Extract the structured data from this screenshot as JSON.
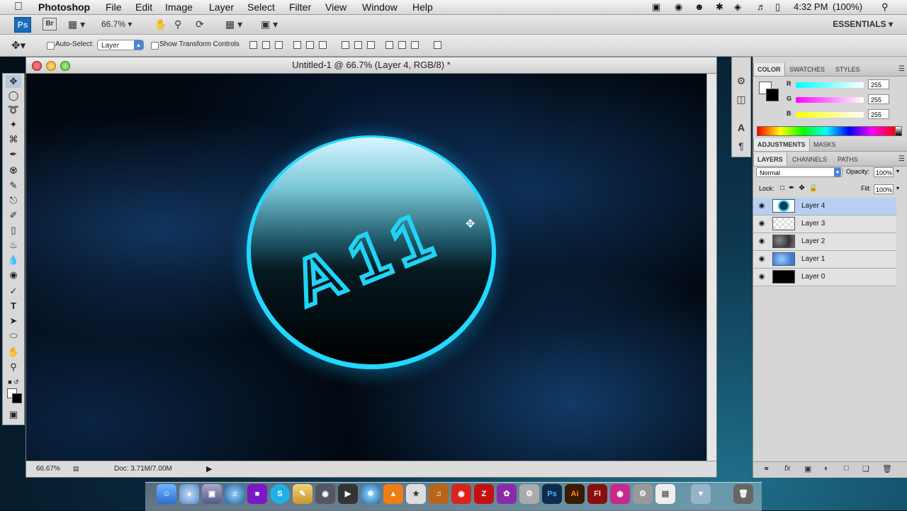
{
  "menubar": {
    "app_name": "Photoshop",
    "menus": [
      "File",
      "Edit",
      "Image",
      "Layer",
      "Select",
      "Filter",
      "View",
      "Window",
      "Help"
    ],
    "clock": "4:32 PM",
    "battery": "(100%)"
  },
  "appbar": {
    "ps_label": "Ps",
    "br_label": "Br",
    "zoom": "66.7%",
    "workspace": "ESSENTIALS"
  },
  "options": {
    "auto_select_label": "Auto-Select:",
    "auto_select_value": "Layer",
    "show_transform_label": "Show Transform Controls"
  },
  "document": {
    "title": "Untitled-1 @ 66.7% (Layer 4, RGB/8) *",
    "status_zoom": "66.67%",
    "status_doc": "Doc: 3.71M/7.00M",
    "canvas_text": "A11"
  },
  "color_panel": {
    "tabs": [
      "COLOR",
      "SWATCHES",
      "STYLES"
    ],
    "r_label": "R",
    "g_label": "G",
    "b_label": "B",
    "r_value": "255",
    "g_value": "255",
    "b_value": "255"
  },
  "adjustments_panel": {
    "tabs": [
      "ADJUSTMENTS",
      "MASKS"
    ]
  },
  "layers_panel": {
    "tabs": [
      "LAYERS",
      "CHANNELS",
      "PATHS"
    ],
    "blend_mode": "Normal",
    "opacity_label": "Opacity:",
    "opacity_value": "100%",
    "lock_label": "Lock:",
    "fill_label": "Fill:",
    "fill_value": "100%",
    "layers": [
      {
        "name": "Layer 4",
        "selected": true
      },
      {
        "name": "Layer 3",
        "selected": false
      },
      {
        "name": "Layer 2",
        "selected": false
      },
      {
        "name": "Layer 1",
        "selected": false
      },
      {
        "name": "Layer 0",
        "selected": false
      }
    ]
  },
  "dock": {
    "ps_label": "Ps",
    "ai_label": "Ai",
    "fl_label": "Fl"
  },
  "colors": {
    "glow": "#19d6ff",
    "ps_blue": "#1b6bb8",
    "selected_row": "#b8cff2"
  }
}
